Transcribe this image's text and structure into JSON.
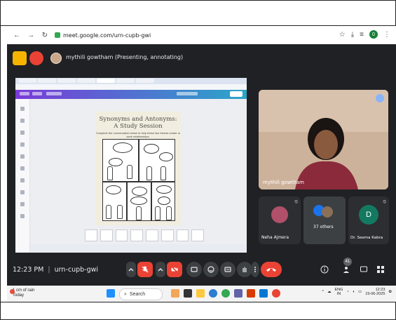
{
  "browser": {
    "url": "meet.google.com/urn-cupb-gwi",
    "profile_initial": "0"
  },
  "meet": {
    "presenter_text": "mythili gowtham (Presenting, annotating)",
    "time_text": "12:23 PM",
    "meeting_code": "urn-cupb-gwi",
    "participant_count": "41",
    "accent_colors": {
      "red": "#ea4335",
      "dark": "#202124",
      "control": "#3c4043"
    }
  },
  "shared_screen": {
    "slide_title_line1": "Synonyms and Antonyms:",
    "slide_title_line2": "A Study Session",
    "slide_subtitle": "Complete the conversation below to help these two friends create or work relationships."
  },
  "tiles": {
    "main_name": "mythili gowtham",
    "p1_name": "Neha Ajmera",
    "others_label": "37 others",
    "p3_initial": "D",
    "p3_name": "Dr. Seema Kabra"
  },
  "taskbar": {
    "weather_line1": "1 cm of rain",
    "weather_line2": "Today",
    "search_placeholder": "Search",
    "lang_line1": "ENG",
    "lang_line2": "IN",
    "clock_time": "12:23",
    "clock_date": "19-06-2025"
  }
}
